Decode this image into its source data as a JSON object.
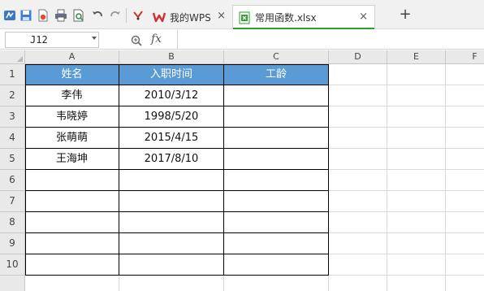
{
  "toolbar": {
    "icons": [
      "logo-icon",
      "save-icon",
      "export-pdf-icon",
      "print-icon",
      "print-preview-icon",
      "undo-icon",
      "redo-icon",
      "format-painter-icon"
    ]
  },
  "tabs": [
    {
      "label": "我的WPS",
      "icon": "wps-logo-icon",
      "close": "×"
    },
    {
      "label": "常用函数.xlsx",
      "icon": "spreadsheet-file-icon",
      "close": "×"
    }
  ],
  "new_tab": "+",
  "formula_bar": {
    "cell_ref": "J12",
    "fx_label": "fx",
    "value": ""
  },
  "columns": [
    "A",
    "B",
    "C",
    "D",
    "E",
    "F"
  ],
  "rows": [
    "1",
    "2",
    "3",
    "4",
    "5",
    "6",
    "7",
    "8",
    "9",
    "10"
  ],
  "table": {
    "headers": [
      "姓名",
      "入职时间",
      "工龄"
    ],
    "data": [
      [
        "李伟",
        "2010/3/12",
        ""
      ],
      [
        "韦晓婷",
        "1998/5/20",
        ""
      ],
      [
        "张萌萌",
        "2015/4/15",
        ""
      ],
      [
        "王海坤",
        "2017/8/10",
        ""
      ]
    ]
  },
  "colors": {
    "header_fill": "#5b9bd5",
    "active_tab_underline": "#2f9d2f",
    "wps_red": "#d32f2f"
  }
}
